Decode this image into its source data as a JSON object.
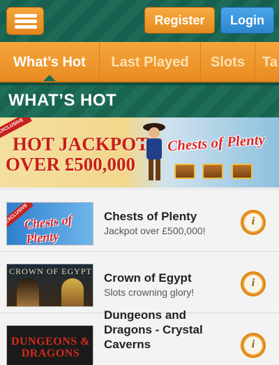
{
  "header": {
    "menu_icon": "hamburger-menu-icon",
    "register_label": "Register",
    "login_label": "Login",
    "colors": {
      "background": "#1d6a57",
      "register": "#f0a030",
      "login": "#3596dc"
    }
  },
  "tabs": [
    {
      "label": "What’s Hot",
      "active": true
    },
    {
      "label": "Last Played",
      "active": false
    },
    {
      "label": "Slots",
      "active": false
    },
    {
      "label": "Ta",
      "active": false
    }
  ],
  "section": {
    "title": "WHAT’S HOT"
  },
  "banner": {
    "corner_label": "EXCLUSIVE",
    "line1": "HOT JACKPOT",
    "line2": "OVER £500,000",
    "logo_text": "Chests of Plenty"
  },
  "games": [
    {
      "title": "Chests of Plenty",
      "subtitle": "Jackpot over £500,000!",
      "thumb_text": "Chests of Plenty",
      "thumb_badge": "EXCLUSIVE",
      "info_icon": "info-icon"
    },
    {
      "title": "Crown of Egypt",
      "subtitle": "Slots crowning glory!",
      "thumb_text": "CROWN OF EGYPT",
      "info_icon": "info-icon"
    },
    {
      "title": "Dungeons and Dragons - Crystal Caverns",
      "subtitle": "",
      "thumb_text": "DUNGEONS & DRAGONS",
      "info_icon": "info-icon"
    }
  ]
}
